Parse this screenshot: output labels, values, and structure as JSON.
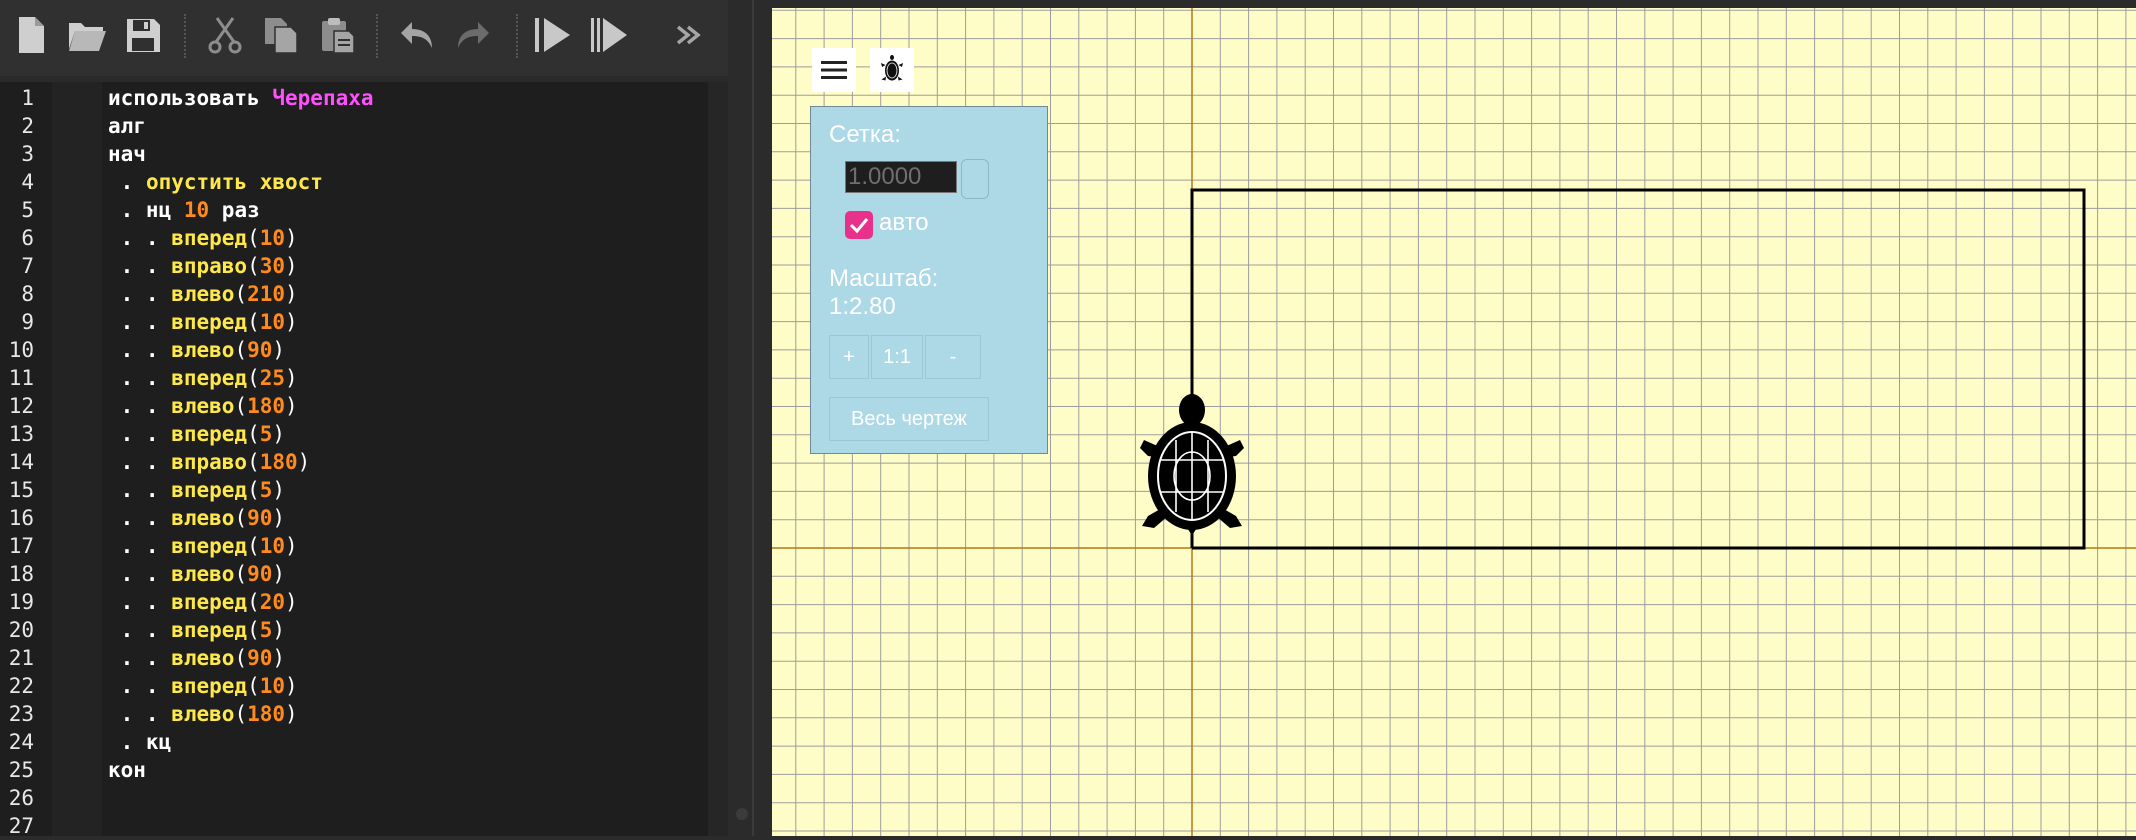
{
  "toolbar": {
    "buttons": [
      {
        "name": "new-file-icon"
      },
      {
        "name": "open-folder-icon"
      },
      {
        "name": "save-icon"
      },
      {
        "name": "cut-icon"
      },
      {
        "name": "copy-icon"
      },
      {
        "name": "paste-icon"
      },
      {
        "name": "undo-icon"
      },
      {
        "name": "redo-icon"
      },
      {
        "name": "run-icon"
      },
      {
        "name": "step-run-icon"
      },
      {
        "name": "more-icon"
      }
    ]
  },
  "editor": {
    "lines": [
      [
        [
          "kw",
          "использовать "
        ],
        [
          "mod",
          "Черепаха"
        ]
      ],
      [
        [
          "kw",
          "алг"
        ]
      ],
      [
        [
          "kw",
          "нач"
        ]
      ],
      [
        [
          "kw",
          " . "
        ],
        [
          "fn",
          "опустить хвост"
        ]
      ],
      [
        [
          "kw",
          " . нц "
        ],
        [
          "num",
          "10"
        ],
        [
          "kw",
          " раз"
        ]
      ],
      [
        [
          "kw",
          " . . "
        ],
        [
          "fn",
          "вперед"
        ],
        [
          "par",
          "("
        ],
        [
          "num",
          "10"
        ],
        [
          "par",
          ")"
        ]
      ],
      [
        [
          "kw",
          " . . "
        ],
        [
          "fn",
          "вправо"
        ],
        [
          "par",
          "("
        ],
        [
          "num",
          "30"
        ],
        [
          "par",
          ")"
        ]
      ],
      [
        [
          "kw",
          " . . "
        ],
        [
          "fn",
          "влево"
        ],
        [
          "par",
          "("
        ],
        [
          "num",
          "210"
        ],
        [
          "par",
          ")"
        ]
      ],
      [
        [
          "kw",
          " . . "
        ],
        [
          "fn",
          "вперед"
        ],
        [
          "par",
          "("
        ],
        [
          "num",
          "10"
        ],
        [
          "par",
          ")"
        ]
      ],
      [
        [
          "kw",
          " . . "
        ],
        [
          "fn",
          "влево"
        ],
        [
          "par",
          "("
        ],
        [
          "num",
          "90"
        ],
        [
          "par",
          ")"
        ]
      ],
      [
        [
          "kw",
          " . . "
        ],
        [
          "fn",
          "вперед"
        ],
        [
          "par",
          "("
        ],
        [
          "num",
          "25"
        ],
        [
          "par",
          ")"
        ]
      ],
      [
        [
          "kw",
          " . . "
        ],
        [
          "fn",
          "влево"
        ],
        [
          "par",
          "("
        ],
        [
          "num",
          "180"
        ],
        [
          "par",
          ")"
        ]
      ],
      [
        [
          "kw",
          " . . "
        ],
        [
          "fn",
          "вперед"
        ],
        [
          "par",
          "("
        ],
        [
          "num",
          "5"
        ],
        [
          "par",
          ")"
        ]
      ],
      [
        [
          "kw",
          " . . "
        ],
        [
          "fn",
          "вправо"
        ],
        [
          "par",
          "("
        ],
        [
          "num",
          "180"
        ],
        [
          "par",
          ")"
        ]
      ],
      [
        [
          "kw",
          " . . "
        ],
        [
          "fn",
          "вперед"
        ],
        [
          "par",
          "("
        ],
        [
          "num",
          "5"
        ],
        [
          "par",
          ")"
        ]
      ],
      [
        [
          "kw",
          " . . "
        ],
        [
          "fn",
          "влево"
        ],
        [
          "par",
          "("
        ],
        [
          "num",
          "90"
        ],
        [
          "par",
          ")"
        ]
      ],
      [
        [
          "kw",
          " . . "
        ],
        [
          "fn",
          "вперед"
        ],
        [
          "par",
          "("
        ],
        [
          "num",
          "10"
        ],
        [
          "par",
          ")"
        ]
      ],
      [
        [
          "kw",
          " . . "
        ],
        [
          "fn",
          "влево"
        ],
        [
          "par",
          "("
        ],
        [
          "num",
          "90"
        ],
        [
          "par",
          ")"
        ]
      ],
      [
        [
          "kw",
          " . . "
        ],
        [
          "fn",
          "вперед"
        ],
        [
          "par",
          "("
        ],
        [
          "num",
          "20"
        ],
        [
          "par",
          ")"
        ]
      ],
      [
        [
          "kw",
          " . . "
        ],
        [
          "fn",
          "вперед"
        ],
        [
          "par",
          "("
        ],
        [
          "num",
          "5"
        ],
        [
          "par",
          ")"
        ]
      ],
      [
        [
          "kw",
          " . . "
        ],
        [
          "fn",
          "влево"
        ],
        [
          "par",
          "("
        ],
        [
          "num",
          "90"
        ],
        [
          "par",
          ")"
        ]
      ],
      [
        [
          "kw",
          " . . "
        ],
        [
          "fn",
          "вперед"
        ],
        [
          "par",
          "("
        ],
        [
          "num",
          "10"
        ],
        [
          "par",
          ")"
        ]
      ],
      [
        [
          "kw",
          " . . "
        ],
        [
          "fn",
          "влево"
        ],
        [
          "par",
          "("
        ],
        [
          "num",
          "180"
        ],
        [
          "par",
          ")"
        ]
      ],
      [
        [
          "kw",
          " . кц"
        ]
      ],
      [
        [
          "kw",
          "кон"
        ]
      ],
      [],
      []
    ]
  },
  "settings": {
    "grid_label": "Сетка:",
    "grid_value": "1.0000",
    "auto_label": "авто",
    "scale_label": "Масштаб:",
    "scale_value": "1:2.80",
    "zoom_in_label": "+",
    "zoom_reset_label": "1:1",
    "zoom_out_label": "-",
    "whole_drawing_label": "Весь чертеж"
  },
  "colors": {
    "canvas_bg": "#fffdc7",
    "grid_line": "#9d9d9d",
    "axis_line": "#b07a1a",
    "panel_bg": "#add8e6",
    "checkbox": "#e8318a",
    "keyword": "#ffffff",
    "module": "#ff4fff",
    "function": "#ffe94a",
    "number": "#ff8a1e"
  }
}
